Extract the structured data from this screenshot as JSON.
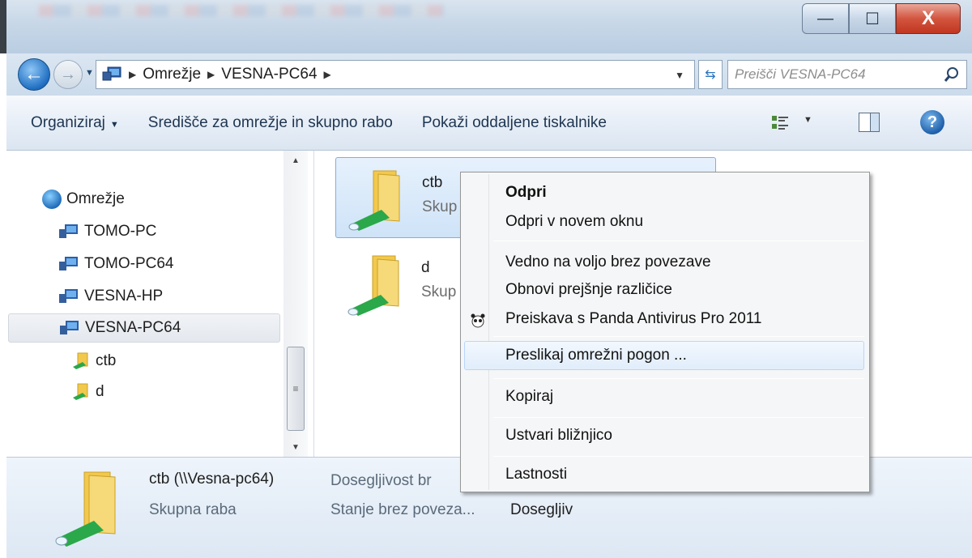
{
  "window": {
    "controls": {
      "minimize": "—",
      "maximize": "☐",
      "close": "X"
    }
  },
  "address": {
    "segments": [
      "Omrežje",
      "VESNA-PC64"
    ],
    "search_placeholder": "Preišči VESNA-PC64"
  },
  "toolbar": {
    "organize": "Organiziraj",
    "network_center": "Središče za omrežje in skupno rabo",
    "show_printers": "Pokaži oddaljene tiskalnike",
    "help": "?"
  },
  "nav": {
    "root": "Omrežje",
    "items": [
      "TOMO-PC",
      "TOMO-PC64",
      "VESNA-HP",
      "VESNA-PC64"
    ],
    "shares": [
      "ctb",
      "d"
    ]
  },
  "content": {
    "items": [
      {
        "name": "ctb",
        "sub": "Skup"
      },
      {
        "name": "d",
        "sub": "Skup"
      }
    ]
  },
  "context_menu": {
    "open": "Odpri",
    "open_new_window": "Odpri v novem oknu",
    "always_offline": "Vedno na voljo brez povezave",
    "restore_versions": "Obnovi prejšnje različice",
    "panda_scan": "Preiskava s Panda Antivirus Pro 2011",
    "map_drive": "Preslikaj omrežni pogon ...",
    "copy": "Kopiraj",
    "create_shortcut": "Ustvari bližnjico",
    "properties": "Lastnosti"
  },
  "details": {
    "name": "ctb (\\\\Vesna-pc64)",
    "offline_label": "Dosegljivost br",
    "type": "Skupna raba",
    "state": "Stanje brez poveza...",
    "availability": "Dosegljiv"
  },
  "colors": {
    "accent": "#1f6fc2",
    "selection": "#cfe3f8",
    "folder": "#f2c94c",
    "share_arrow": "#2aa84a"
  }
}
